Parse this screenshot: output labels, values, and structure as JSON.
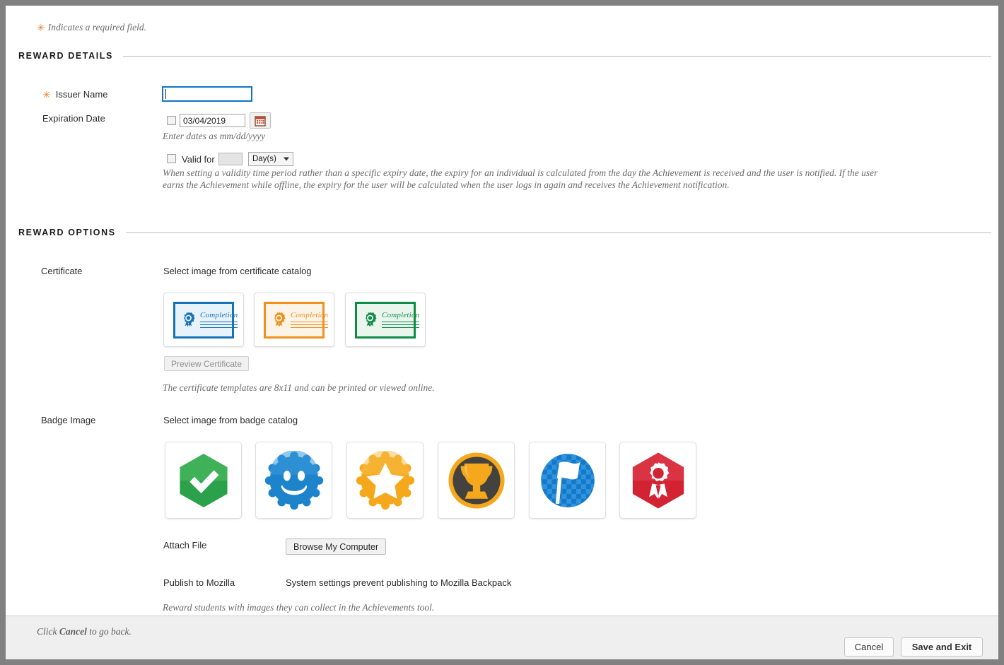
{
  "required_note": {
    "star": "✳",
    "text": "Indicates a required field."
  },
  "sections": {
    "details": "REWARD DETAILS",
    "options": "REWARD OPTIONS"
  },
  "details": {
    "issuer_label": "Issuer Name",
    "issuer_value": "",
    "issuer_required_star": "✳",
    "expiration_label": "Expiration Date",
    "expiration_value": "03/04/2019",
    "expiration_hint": "Enter dates as mm/dd/yyyy",
    "calendar_icon": "calendar-icon",
    "valid_for_label": "Valid for",
    "valid_for_value": "",
    "valid_for_unit": "Day(s)",
    "validity_help": "When setting a validity time period rather than a specific expiry date, the expiry for an individual is calculated from the day the Achievement is received and the user is notified. If the user earns the Achievement while offline, the expiry for the user will be calculated when the user logs in again and receives the Achievement notification."
  },
  "options": {
    "certificate_label": "Certificate",
    "certificate_catalog_label": "Select image from certificate catalog",
    "certificates": [
      {
        "name": "certificate-blue",
        "word": "Completion",
        "color": "#1773b8",
        "fill": "#e8f2fa"
      },
      {
        "name": "certificate-orange",
        "word": "Completion",
        "color": "#f0901e",
        "fill": "#fdf4e8"
      },
      {
        "name": "certificate-green",
        "word": "Completion",
        "color": "#0f8c46",
        "fill": "#eaf5ee"
      }
    ],
    "preview_button": "Preview Certificate",
    "certificate_note": "The certificate templates are 8x11 and can be printed or viewed online.",
    "badge_label": "Badge Image",
    "badge_catalog_label": "Select image from badge catalog",
    "badges": [
      {
        "name": "badge-green-check",
        "color": "#2ba14b"
      },
      {
        "name": "badge-blue-smiley",
        "color": "#1d84cc"
      },
      {
        "name": "badge-orange-star",
        "color": "#f5a81c"
      },
      {
        "name": "badge-gold-trophy",
        "color": "#f5a81c"
      },
      {
        "name": "badge-blue-flag",
        "color": "#1479c9"
      },
      {
        "name": "badge-red-rosette",
        "color": "#d32231"
      }
    ],
    "attach_label": "Attach File",
    "browse_button": "Browse My Computer",
    "publish_label": "Publish to Mozilla",
    "publish_status": "System settings prevent publishing to Mozilla Backpack",
    "reward_note": "Reward students with images they can collect in the Achievements tool."
  },
  "footer": {
    "note_prefix": "Click ",
    "note_bold": "Cancel",
    "note_suffix": " to go back.",
    "cancel_button": "Cancel",
    "save_button": "Save and Exit"
  }
}
